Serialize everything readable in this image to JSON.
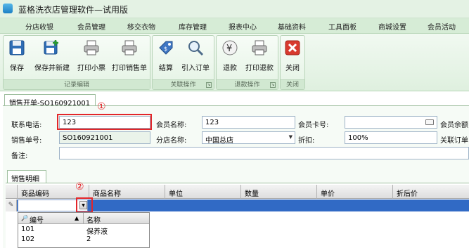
{
  "app": {
    "title": "蓝格洗衣店管理软件—试用版"
  },
  "menu": [
    "分店收银",
    "会员管理",
    "移交衣物",
    "库存管理",
    "报表中心",
    "基础资料",
    "工具面板",
    "商城设置",
    "会员活动"
  ],
  "ribbon": {
    "groups": [
      {
        "label": "记录编辑",
        "buttons": [
          "保存",
          "保存并新建",
          "打印小票",
          "打印销售单"
        ]
      },
      {
        "label": "关联操作",
        "buttons": [
          "结算",
          "引入订单"
        ]
      },
      {
        "label": "退款操作",
        "buttons": [
          "退款",
          "打印退款"
        ]
      },
      {
        "label": "关闭",
        "buttons": [
          "关闭"
        ]
      }
    ]
  },
  "doc_tab": "销售开单-SO160921001",
  "form": {
    "phone_label": "联系电话:",
    "phone_value": "123",
    "member_name_label": "会员名称:",
    "member_name_value": "123",
    "member_card_label": "会员卡号:",
    "member_card_value": "",
    "balance_label": "会员余额",
    "order_no_label": "销售单号:",
    "order_no_value": "SO160921001",
    "store_label": "分店名称:",
    "store_value": "中国总店",
    "discount_label": "折扣:",
    "discount_value": "100%",
    "related_label": "关联订单",
    "remark_label": "备注:",
    "remark_value": ""
  },
  "annotations": [
    "①",
    "②"
  ],
  "detail_tab": "销售明细",
  "grid": {
    "columns": [
      "商品编码",
      "商品名称",
      "单位",
      "数量",
      "单价",
      "折后价"
    ],
    "row_indicator": "✎"
  },
  "popup": {
    "columns": [
      "编号",
      "名称"
    ],
    "rows": [
      {
        "code": "101",
        "name": "保养液"
      },
      {
        "code": "102",
        "name": "2"
      }
    ]
  },
  "colors": {
    "accent_red": "#e3262a",
    "selection_blue": "#316ac5",
    "theme_green": "#d6ecd6"
  }
}
